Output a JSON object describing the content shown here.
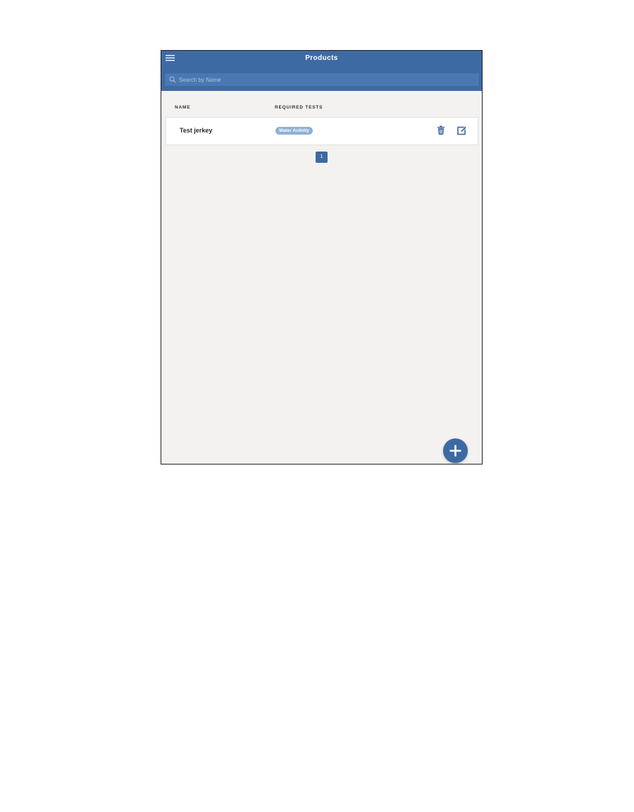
{
  "header": {
    "title": "Products",
    "menu_icon": "hamburger-menu-icon"
  },
  "search": {
    "placeholder": "Search by Name",
    "value": "",
    "icon": "search-icon"
  },
  "table": {
    "columns": [
      "NAME",
      "REQUIRED TESTS"
    ],
    "rows": [
      {
        "name": "Test jerkey",
        "tests": [
          "Water Activity"
        ],
        "actions": [
          "trash-icon",
          "edit-icon"
        ]
      }
    ]
  },
  "pagination": {
    "current_page": "1"
  },
  "fab": {
    "icon": "plus-icon"
  },
  "colors": {
    "primary": "#3e6aa3",
    "search_bg": "#4a78b2",
    "chip": "#8fb0d4",
    "background": "#f3f2f0"
  }
}
